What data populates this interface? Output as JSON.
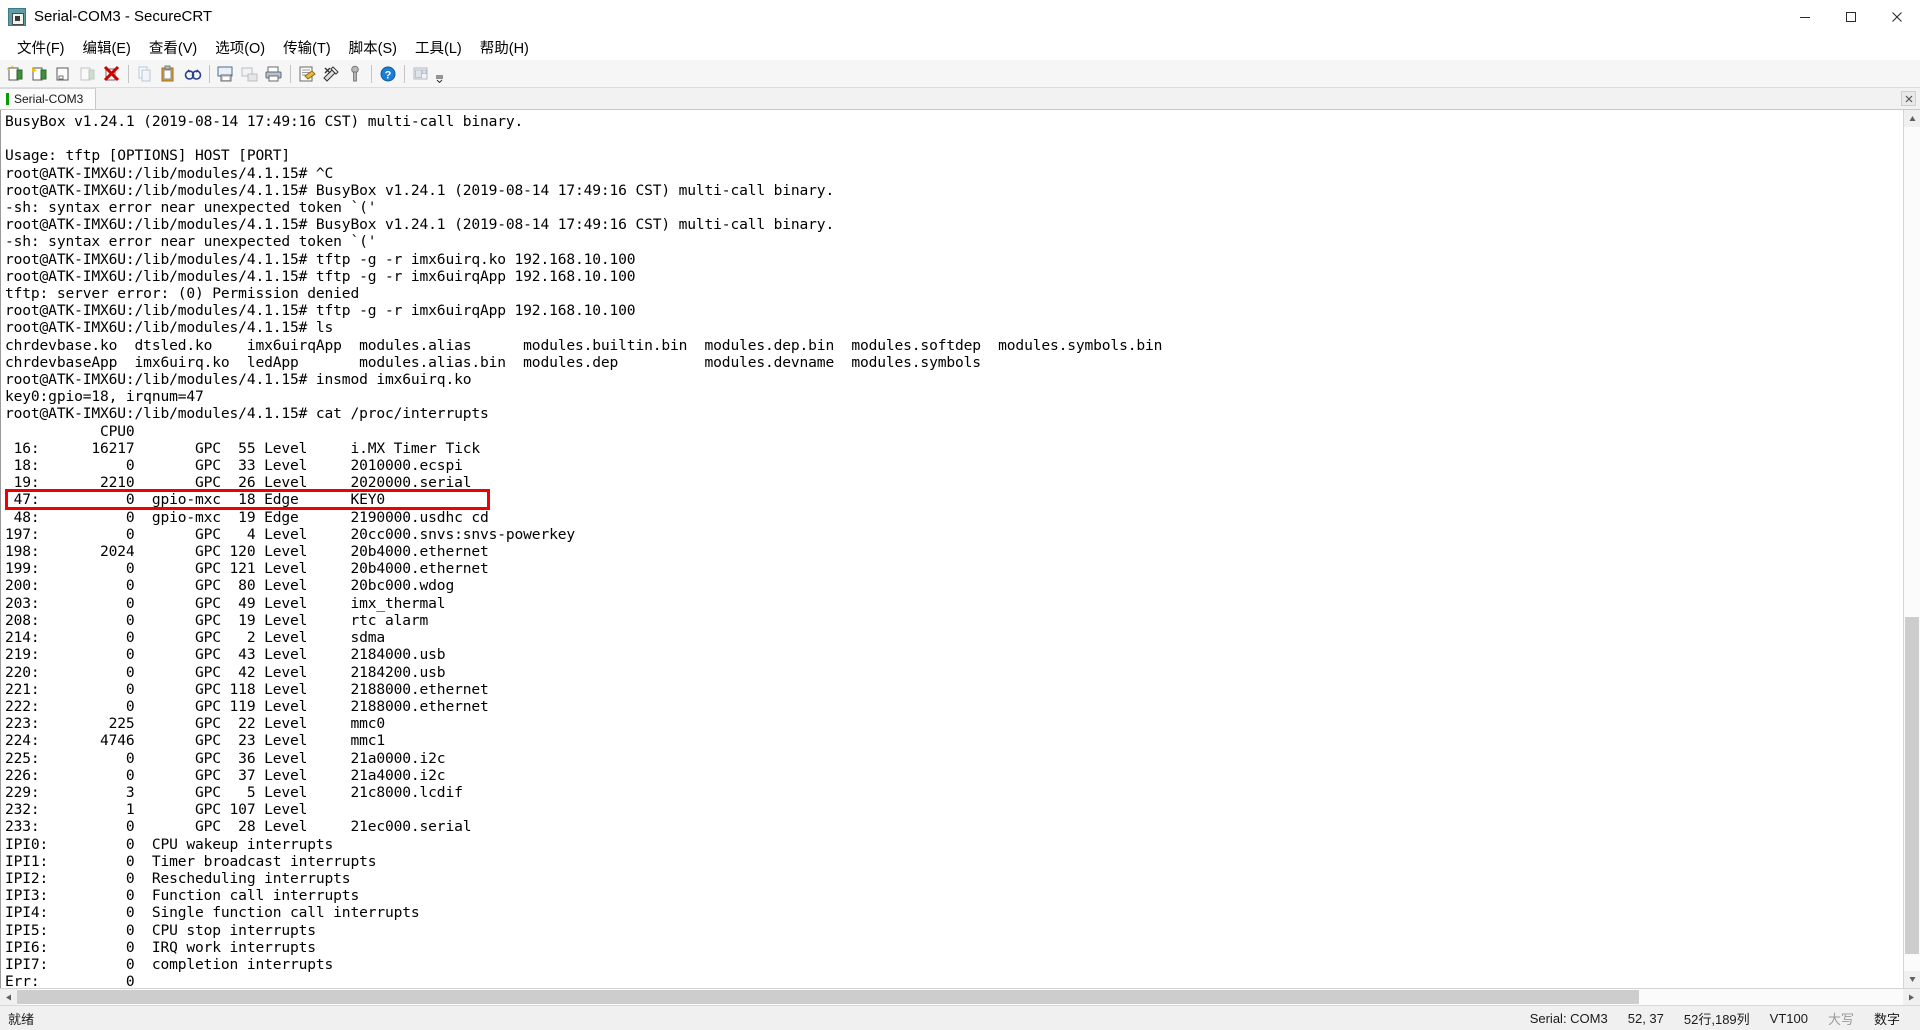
{
  "window": {
    "title": "Serial-COM3 - SecureCRT",
    "app_icon": "securecrt-icon",
    "minimize_label": "—",
    "maximize_label": "❐",
    "close_label": "✕"
  },
  "menubar": {
    "items": [
      {
        "label": "文件(F)",
        "name": "menu-file"
      },
      {
        "label": "编辑(E)",
        "name": "menu-edit"
      },
      {
        "label": "查看(V)",
        "name": "menu-view"
      },
      {
        "label": "选项(O)",
        "name": "menu-options"
      },
      {
        "label": "传输(T)",
        "name": "menu-transfer"
      },
      {
        "label": "脚本(S)",
        "name": "menu-script"
      },
      {
        "label": "工具(L)",
        "name": "menu-tools"
      },
      {
        "label": "帮助(H)",
        "name": "menu-help"
      }
    ]
  },
  "toolbar": {
    "buttons": [
      {
        "name": "new-session-icon",
        "tip": "New Session"
      },
      {
        "name": "connect-icon",
        "tip": "Connect"
      },
      {
        "name": "connect-local-shell-icon",
        "tip": "Connect Local Shell"
      },
      {
        "name": "reconnect-icon",
        "tip": "Reconnect"
      },
      {
        "name": "disconnect-icon",
        "tip": "Disconnect"
      },
      {
        "name": "separator-1",
        "tip": ""
      },
      {
        "name": "copy-icon",
        "tip": "Copy"
      },
      {
        "name": "paste-icon",
        "tip": "Paste"
      },
      {
        "name": "find-icon",
        "tip": "Find"
      },
      {
        "name": "separator-2",
        "tip": ""
      },
      {
        "name": "print-screen-icon",
        "tip": "Print Screen"
      },
      {
        "name": "log-session-icon",
        "tip": "Log Session"
      },
      {
        "name": "print-icon",
        "tip": "Print"
      },
      {
        "name": "separator-3",
        "tip": ""
      },
      {
        "name": "session-options-icon",
        "tip": "Session Options"
      },
      {
        "name": "global-options-icon",
        "tip": "Global Options"
      },
      {
        "name": "key-icon",
        "tip": "Keys"
      },
      {
        "name": "separator-4",
        "tip": ""
      },
      {
        "name": "help-icon",
        "tip": "Help"
      },
      {
        "name": "separator-5",
        "tip": ""
      },
      {
        "name": "tile-icon",
        "tip": "Tile"
      }
    ],
    "overflow_label": "⬍"
  },
  "tabs": {
    "items": [
      {
        "label": "Serial-COM3",
        "name": "tab-serial-com3",
        "active": true
      }
    ],
    "close_label": "✕"
  },
  "terminal": {
    "lines": [
      "BusyBox v1.24.1 (2019-08-14 17:49:16 CST) multi-call binary.",
      "",
      "Usage: tftp [OPTIONS] HOST [PORT]",
      "root@ATK-IMX6U:/lib/modules/4.1.15# ^C",
      "root@ATK-IMX6U:/lib/modules/4.1.15# BusyBox v1.24.1 (2019-08-14 17:49:16 CST) multi-call binary.",
      "-sh: syntax error near unexpected token `('",
      "root@ATK-IMX6U:/lib/modules/4.1.15# BusyBox v1.24.1 (2019-08-14 17:49:16 CST) multi-call binary.",
      "-sh: syntax error near unexpected token `('",
      "root@ATK-IMX6U:/lib/modules/4.1.15# tftp -g -r imx6uirq.ko 192.168.10.100",
      "root@ATK-IMX6U:/lib/modules/4.1.15# tftp -g -r imx6uirqApp 192.168.10.100",
      "tftp: server error: (0) Permission denied",
      "root@ATK-IMX6U:/lib/modules/4.1.15# tftp -g -r imx6uirqApp 192.168.10.100",
      "root@ATK-IMX6U:/lib/modules/4.1.15# ls",
      "chrdevbase.ko  dtsled.ko    imx6uirqApp  modules.alias      modules.builtin.bin  modules.dep.bin  modules.softdep  modules.symbols.bin",
      "chrdevbaseApp  imx6uirq.ko  ledApp       modules.alias.bin  modules.dep          modules.devname  modules.symbols",
      "root@ATK-IMX6U:/lib/modules/4.1.15# insmod imx6uirq.ko",
      "key0:gpio=18, irqnum=47",
      "root@ATK-IMX6U:/lib/modules/4.1.15# cat /proc/interrupts",
      "           CPU0",
      " 16:      16217       GPC  55 Level     i.MX Timer Tick",
      " 18:          0       GPC  33 Level     2010000.ecspi",
      " 19:       2210       GPC  26 Level     2020000.serial",
      " 47:          0  gpio-mxc  18 Edge      KEY0",
      " 48:          0  gpio-mxc  19 Edge      2190000.usdhc cd",
      "197:          0       GPC   4 Level     20cc000.snvs:snvs-powerkey",
      "198:       2024       GPC 120 Level     20b4000.ethernet",
      "199:          0       GPC 121 Level     20b4000.ethernet",
      "200:          0       GPC  80 Level     20bc000.wdog",
      "203:          0       GPC  49 Level     imx_thermal",
      "208:          0       GPC  19 Level     rtc alarm",
      "214:          0       GPC   2 Level     sdma",
      "219:          0       GPC  43 Level     2184000.usb",
      "220:          0       GPC  42 Level     2184200.usb",
      "221:          0       GPC 118 Level     2188000.ethernet",
      "222:          0       GPC 119 Level     2188000.ethernet",
      "223:        225       GPC  22 Level     mmc0",
      "224:       4746       GPC  23 Level     mmc1",
      "225:          0       GPC  36 Level     21a0000.i2c",
      "226:          0       GPC  37 Level     21a4000.i2c",
      "229:          3       GPC   5 Level     21c8000.lcdif",
      "232:          1       GPC 107 Level",
      "233:          0       GPC  28 Level     21ec000.serial",
      "IPI0:         0  CPU wakeup interrupts",
      "IPI1:         0  Timer broadcast interrupts",
      "IPI2:         0  Rescheduling interrupts",
      "IPI3:         0  Function call interrupts",
      "IPI4:         0  Single function call interrupts",
      "IPI5:         0  CPU stop interrupts",
      "IPI6:         0  IRQ work interrupts",
      "IPI7:         0  completion interrupts",
      "Err:          0"
    ],
    "prompt": "root@ATK-IMX6U:/lib/modules/4.1.15# ",
    "highlight": {
      "name": "irq-47-highlight",
      "color": "#f00000",
      "target_line": " 47:          0  gpio-mxc  18 Edge      KEY0"
    }
  },
  "scrollbars": {
    "vertical_up": "▲",
    "vertical_down": "▼",
    "horizontal_left": "◀",
    "horizontal_right": "▶"
  },
  "statusbar": {
    "ready": "就绪",
    "serial": "Serial: COM3",
    "cursor": "52, 37",
    "dimensions": "52行,189列",
    "emulation": "VT100",
    "caps": "大写",
    "num": "数字"
  }
}
